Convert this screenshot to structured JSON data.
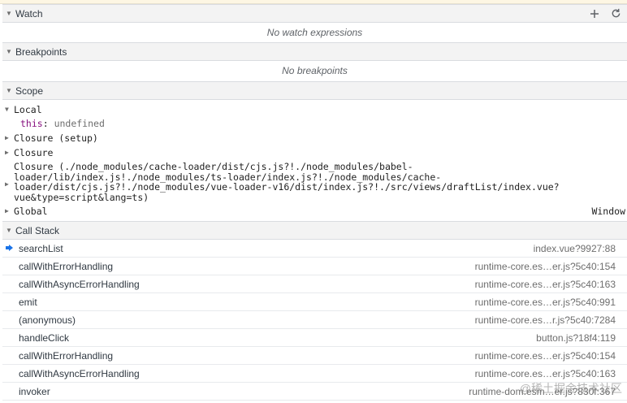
{
  "watch": {
    "title": "Watch",
    "empty": "No watch expressions",
    "tools": {
      "add_icon": "plus-icon",
      "refresh_icon": "refresh-icon"
    }
  },
  "breakpoints": {
    "title": "Breakpoints",
    "empty": "No breakpoints"
  },
  "scope": {
    "title": "Scope",
    "local": {
      "label": "Local",
      "this_name": "this",
      "this_sep": ": ",
      "this_value": "undefined"
    },
    "closure_setup": "Closure (setup)",
    "closure": "Closure",
    "closure_long": [
      "Closure (./node_modules/cache-loader/dist/cjs.js?!./node_modules/babel-",
      "loader/lib/index.js!./node_modules/ts-loader/index.js?!./node_modules/cache-",
      "loader/dist/cjs.js?!./node_modules/vue-loader-v16/dist/index.js?!./src/views/draftList/index.vue?",
      "vue&type=script&lang=ts)"
    ],
    "global": {
      "label": "Global",
      "value": "Window"
    }
  },
  "call_stack": {
    "title": "Call Stack",
    "frames": [
      {
        "name": "searchList",
        "location": "index.vue?9927:88",
        "current": true
      },
      {
        "name": "callWithErrorHandling",
        "location": "runtime-core.es…er.js?5c40:154"
      },
      {
        "name": "callWithAsyncErrorHandling",
        "location": "runtime-core.es…er.js?5c40:163"
      },
      {
        "name": "emit",
        "location": "runtime-core.es…er.js?5c40:991"
      },
      {
        "name": "(anonymous)",
        "location": "runtime-core.es…r.js?5c40:7284"
      },
      {
        "name": "handleClick",
        "location": "button.js?18f4:119"
      },
      {
        "name": "callWithErrorHandling",
        "location": "runtime-core.es…er.js?5c40:154"
      },
      {
        "name": "callWithAsyncErrorHandling",
        "location": "runtime-core.es…er.js?5c40:163"
      },
      {
        "name": "invoker",
        "location": "runtime-dom.esm…er.js?830f:367"
      }
    ]
  },
  "watermark": "@稀土掘金技术社区",
  "colors": {
    "accent": "#1a73e8",
    "header_bg": "#f3f3f3",
    "border": "#dadce0"
  }
}
